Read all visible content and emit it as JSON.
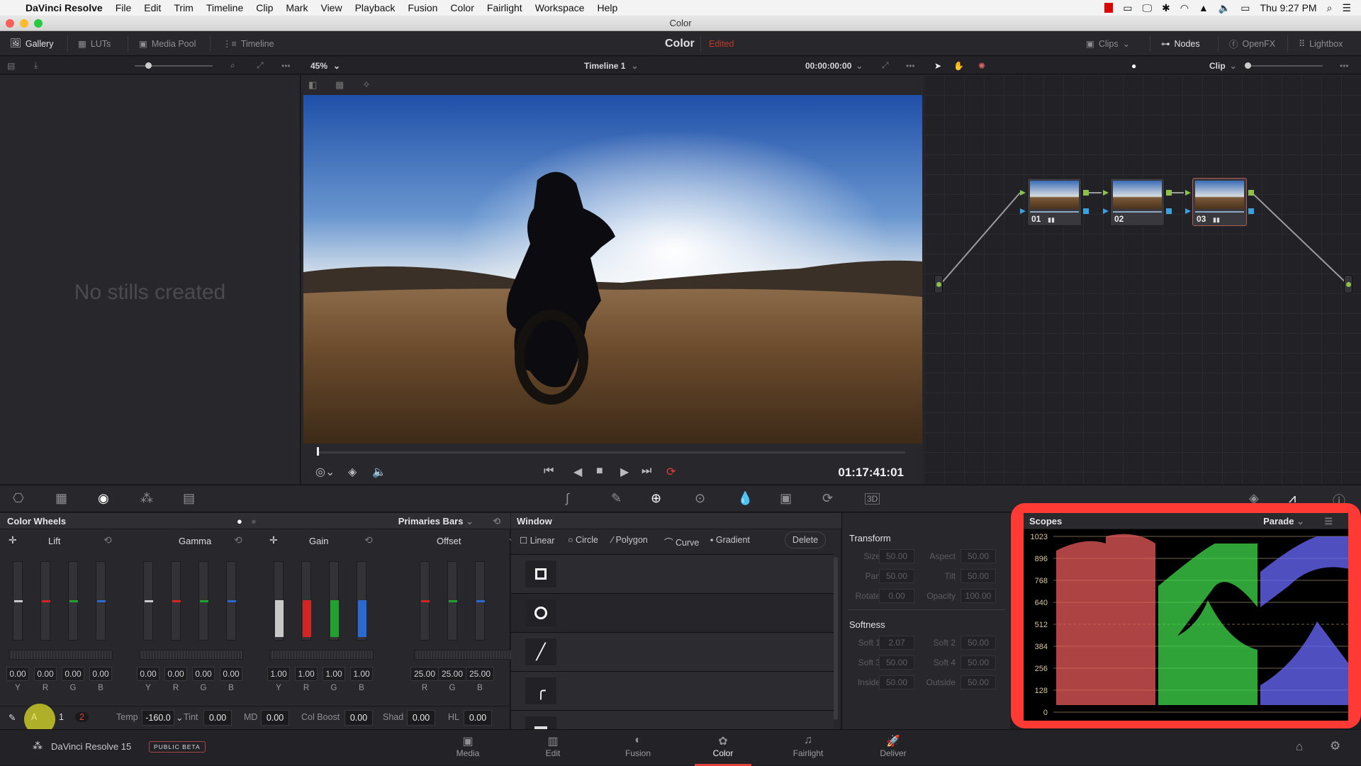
{
  "menubar": {
    "app_name": "DaVinci Resolve",
    "items": [
      "File",
      "Edit",
      "Trim",
      "Timeline",
      "Clip",
      "Mark",
      "View",
      "Playback",
      "Fusion",
      "Color",
      "Fairlight",
      "Workspace",
      "Help"
    ],
    "clock": "Thu 9:27 PM"
  },
  "window": {
    "title": "Color"
  },
  "header": {
    "left_tabs": [
      {
        "label": "Gallery",
        "icon": "gallery-icon",
        "active": true
      },
      {
        "label": "LUTs",
        "icon": "luts-icon",
        "active": false
      },
      {
        "label": "Media Pool",
        "icon": "media-pool-icon",
        "active": false
      },
      {
        "label": "Timeline",
        "icon": "timeline-icon",
        "active": false
      }
    ],
    "page_title": "Color",
    "status": "Edited",
    "right_tabs": [
      {
        "label": "Clips",
        "icon": "clips-icon",
        "active": false
      },
      {
        "label": "Nodes",
        "icon": "nodes-icon",
        "active": true
      },
      {
        "label": "OpenFX",
        "icon": "openfx-icon",
        "active": false
      },
      {
        "label": "Lightbox",
        "icon": "lightbox-icon",
        "active": false
      }
    ]
  },
  "toolbar": {
    "zoom": "45%",
    "timeline_name": "Timeline 1",
    "source_timecode": "00:00:00:00",
    "node_mode": "Clip"
  },
  "gallery": {
    "empty_message": "No stills created"
  },
  "viewer": {
    "timecode": "01:17:41:01",
    "playhead_fraction": 0.0
  },
  "nodes": [
    {
      "label": "01",
      "has_grade_indicator": true,
      "selected": false
    },
    {
      "label": "02",
      "has_grade_indicator": false,
      "selected": false
    },
    {
      "label": "03",
      "has_grade_indicator": true,
      "selected": true
    }
  ],
  "color_wheels": {
    "title": "Color Wheels",
    "mode": "Primaries Bars",
    "groups": [
      {
        "name": "Lift",
        "channels": [
          "Y",
          "R",
          "G",
          "B"
        ],
        "values": [
          "0.00",
          "0.00",
          "0.00",
          "0.00"
        ]
      },
      {
        "name": "Gamma",
        "channels": [
          "Y",
          "R",
          "G",
          "B"
        ],
        "values": [
          "0.00",
          "0.00",
          "0.00",
          "0.00"
        ]
      },
      {
        "name": "Gain",
        "channels": [
          "Y",
          "R",
          "G",
          "B"
        ],
        "values": [
          "1.00",
          "1.00",
          "1.00",
          "1.00"
        ]
      },
      {
        "name": "Offset",
        "channels": [
          "R",
          "G",
          "B"
        ],
        "values": [
          "25.00",
          "25.00",
          "25.00"
        ]
      }
    ],
    "footer": {
      "page_a": "A",
      "page_1": "1",
      "page_2": "2",
      "temp_label": "Temp",
      "temp": "-160.0",
      "tint_label": "Tint",
      "tint": "0.00",
      "md_label": "MD",
      "md": "0.00",
      "colboost_label": "Col Boost",
      "colboost": "0.00",
      "shad_label": "Shad",
      "shad": "0.00",
      "hl_label": "HL",
      "hl": "0.00"
    }
  },
  "window_panel": {
    "title": "Window",
    "tools": [
      "Linear",
      "Circle",
      "Polygon",
      "Curve",
      "Gradient"
    ],
    "delete_label": "Delete",
    "shapes": [
      "square",
      "circle",
      "line",
      "curve",
      "gradient"
    ]
  },
  "transform": {
    "title": "Transform",
    "fields": [
      {
        "label": "Size",
        "value": "50.00"
      },
      {
        "label": "Aspect",
        "value": "50.00"
      },
      {
        "label": "Pan",
        "value": "50.00"
      },
      {
        "label": "Tilt",
        "value": "50.00"
      },
      {
        "label": "Rotate",
        "value": "0.00"
      },
      {
        "label": "Opacity",
        "value": "100.00"
      }
    ],
    "softness_title": "Softness",
    "softness": [
      {
        "label": "Soft 1",
        "value": "2.07"
      },
      {
        "label": "Soft 2",
        "value": "50.00"
      },
      {
        "label": "Soft 3",
        "value": "50.00"
      },
      {
        "label": "Soft 4",
        "value": "50.00"
      },
      {
        "label": "Inside",
        "value": "50.00"
      },
      {
        "label": "Outside",
        "value": "50.00"
      }
    ]
  },
  "scopes": {
    "title": "Scopes",
    "mode": "Parade",
    "scale": [
      "1023",
      "896",
      "768",
      "640",
      "512",
      "384",
      "256",
      "128",
      "0"
    ],
    "highlight_color": "#ff3a35"
  },
  "footer": {
    "product": "DaVinci Resolve 15",
    "badge": "PUBLIC BETA",
    "pages": [
      {
        "label": "Media",
        "icon": "media-icon",
        "active": false
      },
      {
        "label": "Edit",
        "icon": "edit-icon",
        "active": false
      },
      {
        "label": "Fusion",
        "icon": "fusion-icon",
        "active": false
      },
      {
        "label": "Color",
        "icon": "color-icon",
        "active": true
      },
      {
        "label": "Fairlight",
        "icon": "fairlight-icon",
        "active": false
      },
      {
        "label": "Deliver",
        "icon": "deliver-icon",
        "active": false
      }
    ]
  },
  "colors": {
    "accent_red": "#e0403a",
    "scope_red": "#e85a5a",
    "scope_green": "#3fd94a",
    "scope_blue": "#6a6aff"
  }
}
